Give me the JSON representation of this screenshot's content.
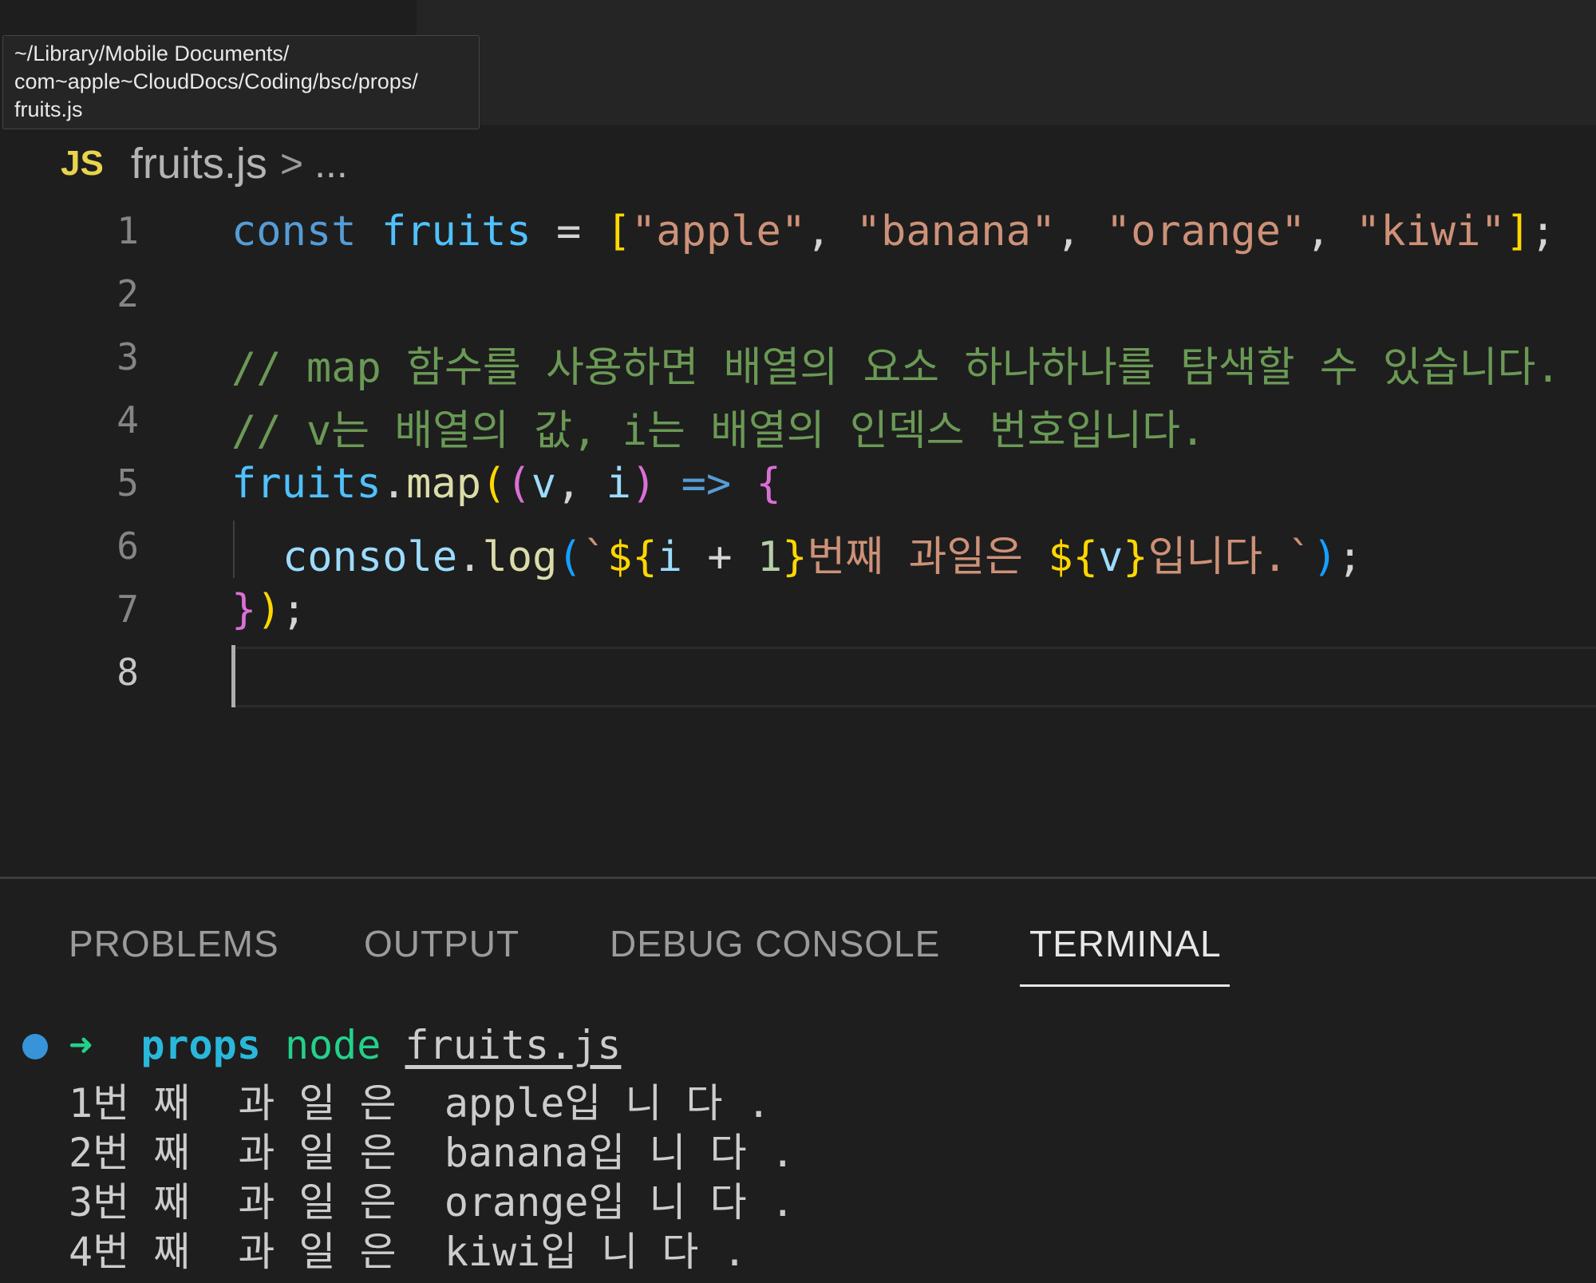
{
  "tooltip": {
    "lines": [
      "~/Library/Mobile Documents/",
      "com~apple~CloudDocs/Coding/bsc/props/",
      "fruits.js"
    ]
  },
  "breadcrumb": {
    "icon": "JS",
    "file": "fruits.js",
    "separator": ">",
    "more": "..."
  },
  "editor": {
    "line_numbers": [
      "1",
      "2",
      "3",
      "4",
      "5",
      "6",
      "7",
      "8"
    ],
    "tokens": {
      "l1": [
        "const",
        "fruits",
        "=",
        "[",
        "\"apple\"",
        ", ",
        "\"banana\"",
        ", ",
        "\"orange\"",
        ", ",
        "\"kiwi\"",
        "]",
        ";"
      ],
      "l3": "// map 함수를 사용하면 배열의 요소 하나하나를 탐색할 수 있습니다.",
      "l4": "// v는 배열의 값, i는 배열의 인덱스 번호입니다.",
      "l5": [
        "fruits",
        ".",
        "map",
        "(",
        "(",
        "v",
        ", ",
        "i",
        ")",
        " => ",
        "{"
      ],
      "l6": [
        "console",
        ".",
        "log",
        "(",
        "`",
        "${",
        "i",
        " + ",
        "1",
        "}",
        "번째 과일은 ",
        "${",
        "v",
        "}",
        "입니다.",
        "`",
        ")",
        ";"
      ],
      "l7": [
        "}",
        ")",
        ";"
      ]
    }
  },
  "panel": {
    "tabs": [
      "PROBLEMS",
      "OUTPUT",
      "DEBUG CONSOLE",
      "TERMINAL"
    ],
    "active_tab": "TERMINAL"
  },
  "terminal": {
    "prompt_arrow": "➜",
    "dir": "props",
    "cmd": "node",
    "arg": "fruits.js",
    "output": [
      "1번 째  과 일 은  apple입 니 다 .",
      "2번 째  과 일 은  banana입 니 다 .",
      "3번 째  과 일 은  orange입 니 다 .",
      "4번 째  과 일 은  kiwi입 니 다 ."
    ]
  },
  "colors": {
    "keyword": "#569cd6",
    "string": "#ce9178",
    "comment": "#6a9955",
    "function": "#dcdcaa",
    "terminal_dir": "#29b8db",
    "terminal_cmd": "#23d18b"
  }
}
